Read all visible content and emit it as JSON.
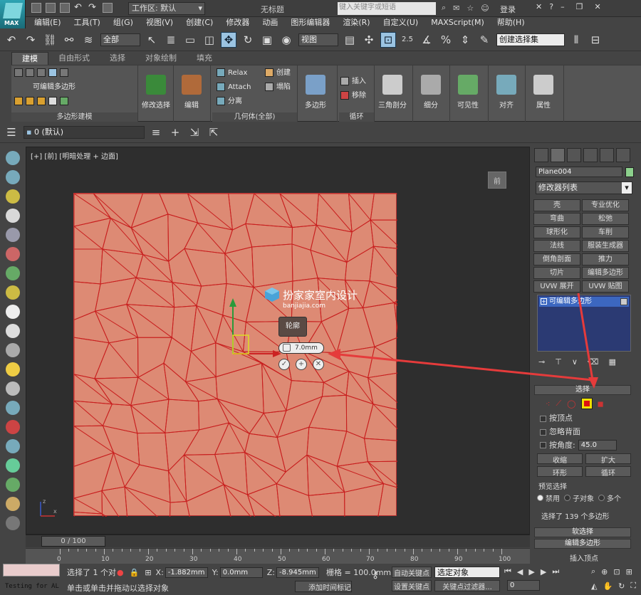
{
  "titlebar": {
    "logo_text": "MAX",
    "workspace": "工作区: 默认",
    "doc_title": "无标题",
    "search_placeholder": "键入关键字或短语",
    "login": "登录"
  },
  "menu": [
    "编辑(E)",
    "工具(T)",
    "组(G)",
    "视图(V)",
    "创建(C)",
    "修改器",
    "动画",
    "图形编辑器",
    "渲染(R)",
    "自定义(U)",
    "MAXScript(M)",
    "帮助(H)"
  ],
  "toolbar": {
    "filter_select": "全部",
    "refcoord_select": "视图",
    "snap_label": "2.5",
    "named_selection": "创建选择集"
  },
  "ribbon": {
    "tabs": [
      "建模",
      "自由形式",
      "选择",
      "对象绘制",
      "填充"
    ],
    "active_tab": "建模",
    "poly_label": "可编辑多边形",
    "panel_polymodel": "多边形建模",
    "modify_selection": "修改选择",
    "edit": "编辑",
    "relax": "Relax",
    "create": "创建",
    "attach": "Attach",
    "collapse": "塌陷",
    "detach": "分离",
    "geometry_all": "几何体(全部)",
    "polygons": "多边形",
    "insert": "插入",
    "remove": "移除",
    "loops": "循环",
    "triangulate": "三角剖分",
    "subdivide": "细分",
    "visibility": "可见性",
    "align": "对齐",
    "properties": "属性"
  },
  "layerbar": {
    "layer": "0 (默认)"
  },
  "viewport": {
    "label": "[+] [前] [明暗处理 + 边面]",
    "caddy_title": "轮廓",
    "caddy_value": "7.0mm",
    "watermark_main": "扮家家室内设计",
    "watermark_sub": "banjiajia.com",
    "viewcube_label": "前",
    "axis_x": "x",
    "axis_z": "z"
  },
  "cmdpanel": {
    "object_name": "Plane004",
    "modifier_list": "修改器列表",
    "modifier_buttons": [
      "壳",
      "专业优化",
      "弯曲",
      "松弛",
      "球形化",
      "车削",
      "法线",
      "服装生成器",
      "倒角剖面",
      "推力",
      "切片",
      "编辑多边形",
      "UVW 展开",
      "UVW 贴图"
    ],
    "stack_item": "可编辑多边形",
    "selection_title": "选择",
    "by_vertex": "按顶点",
    "ignore_backface": "忽略背面",
    "by_angle": "按角度:",
    "angle_value": "45.0",
    "shrink": "收缩",
    "grow": "扩大",
    "ring": "环形",
    "loop": "循环",
    "preview_selection": "预览选择",
    "disabled": "禁用",
    "subobject": "子对象",
    "multi": "多个",
    "selected_count": "选择了 139 个多边形",
    "soft_selection": "软选择",
    "edit_polygons": "编辑多边形",
    "insert_vertex": "插入顶点"
  },
  "timeline": {
    "frame": "0 / 100",
    "ticks": [
      "0",
      "10",
      "20",
      "30",
      "40",
      "50",
      "60",
      "70",
      "80",
      "90",
      "100"
    ]
  },
  "status": {
    "mini_listener": "Testing for AL",
    "selected": "选择了 1 个对",
    "prompt": "单击或单击并拖动以选择对象",
    "x_label": "X:",
    "x": "-1.882mm",
    "y_label": "Y:",
    "y": "0.0mm",
    "z_label": "Z:",
    "z": "-8.945mm",
    "grid": "栅格 = 100.0mm",
    "add_time_tag": "添加时间标记",
    "autokey": "自动关键点",
    "set_key": "设置关键点",
    "key_mode": "选定对象",
    "key_filters": "关键点过滤器...",
    "current_frame": "0"
  },
  "colors": {
    "accent_red": "#e53b3b",
    "plane_fill": "#dd8a74",
    "plane_edge": "#c81e1e",
    "stack_blue": "#2b3a73"
  }
}
